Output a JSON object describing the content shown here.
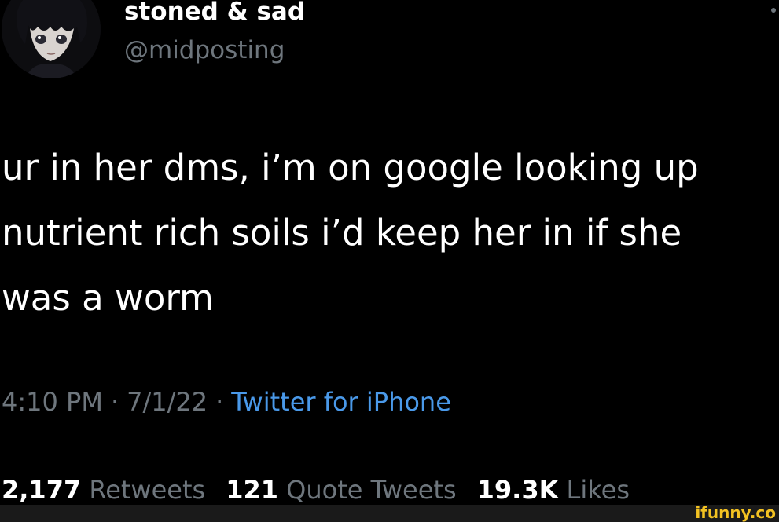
{
  "tweet": {
    "display_name": "stoned & sad",
    "handle": "@midposting",
    "text_lines": [
      "ur in her dms, i’m on google looking up",
      "nutrient rich soils i’d keep her in if she",
      "was a worm"
    ],
    "time": "4:10 PM",
    "date": "7/1/22",
    "separator": "·",
    "source": "Twitter for iPhone",
    "stats": {
      "retweets_count": "2,177",
      "retweets_label": "Retweets",
      "quotes_count": "121",
      "quotes_label": "Quote Tweets",
      "likes_count": "19.3K",
      "likes_label": "Likes"
    }
  },
  "watermark": "ifunny.co",
  "colors": {
    "background": "#000000",
    "primary_text": "#ffffff",
    "secondary_text": "#6e767d",
    "link": "#4a99e9",
    "divider": "#2f3336",
    "watermark": "#f3c222"
  }
}
